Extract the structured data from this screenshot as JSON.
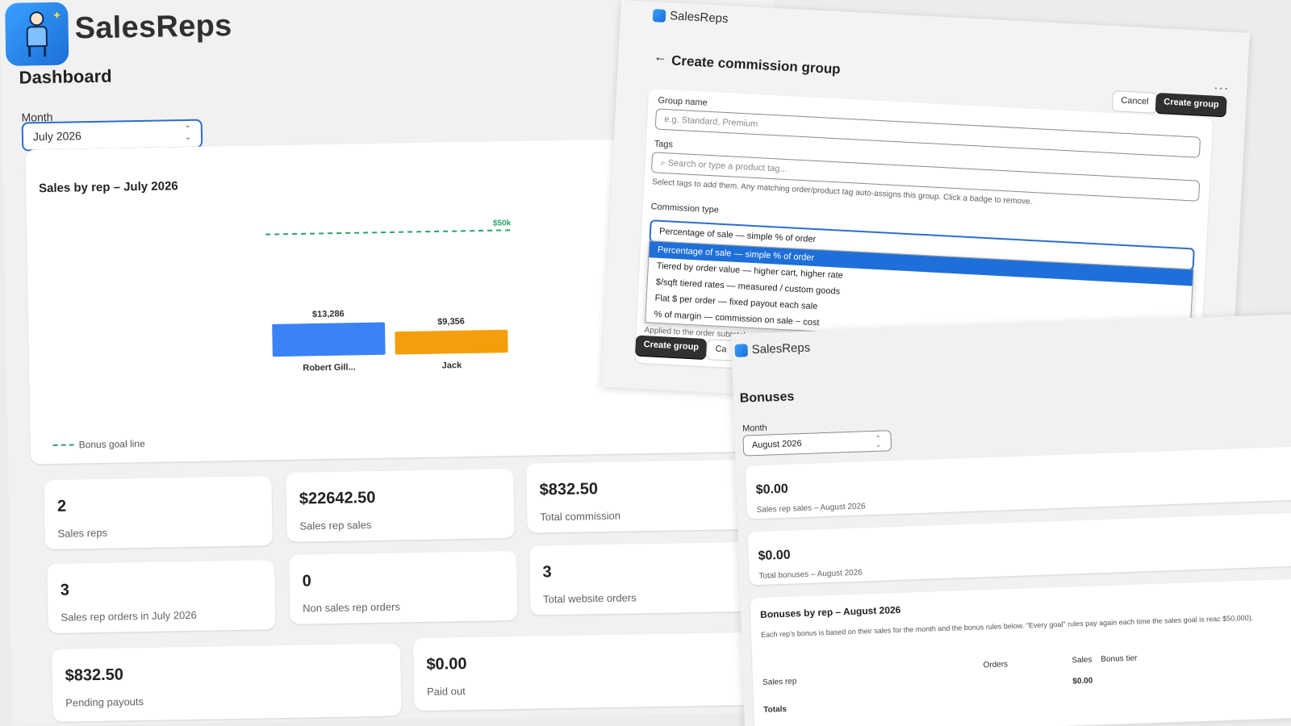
{
  "dashboard": {
    "brand": "SalesReps",
    "title": "Dashboard",
    "month_label": "Month",
    "month_value": "July 2026",
    "chart_card_title": "Sales by rep – July 2026",
    "legend_label": "Bonus goal line",
    "goal_label": "$50k",
    "stats": [
      {
        "value": "2",
        "label": "Sales reps"
      },
      {
        "value": "$22642.50",
        "label": "Sales rep sales"
      },
      {
        "value": "$832.50",
        "label": "Total commission"
      },
      {
        "value": "3",
        "label": "Sales rep orders in July 2026"
      },
      {
        "value": "0",
        "label": "Non sales rep orders"
      },
      {
        "value": "3",
        "label": "Total website orders"
      },
      {
        "value": "$832.50",
        "label": "Pending payouts"
      },
      {
        "value": "$0.00",
        "label": "Paid out"
      }
    ]
  },
  "chart_data": {
    "type": "bar",
    "title": "Sales by rep – July 2026",
    "categories": [
      "Robert Gill...",
      "Jack"
    ],
    "values": [
      13286,
      9356
    ],
    "value_labels": [
      "$13,286",
      "$9,356"
    ],
    "colors": [
      "#3b82f6",
      "#f59e0b"
    ],
    "goal_line": {
      "value": 50000,
      "label": "$50k",
      "color": "#27a36a"
    },
    "legend": [
      "Bonus goal line"
    ],
    "ylim": [
      0,
      60000
    ],
    "grid": false,
    "legend_position": "bottom-left"
  },
  "commission_group": {
    "brand": "SalesReps",
    "title": "Create commission group",
    "cancel_label": "Cancel",
    "create_label": "Create group",
    "group_name_label": "Group name",
    "group_name_placeholder": "e.g. Standard, Premium",
    "tags_label": "Tags",
    "tags_placeholder": "Search or type a product tag...",
    "tags_help": "Select tags to add them. Any matching order/product tag auto-assigns this group. Click a badge to remove.",
    "commission_type_label": "Commission type",
    "commission_type_value": "Percentage of sale — simple % of order",
    "options": [
      "Percentage of sale — simple % of order",
      "Tiered by order value — higher cart, higher rate",
      "$/sqft tiered rates — measured / custom goods",
      "Flat $ per order — fixed payout each sale",
      "% of margin — commission on sale − cost"
    ],
    "applied_note": "Applied to the order subtotal.",
    "bottom_create_label": "Create group",
    "bottom_cancel_label": "Ca"
  },
  "bonuses": {
    "brand": "SalesReps",
    "title": "Bonuses",
    "month_label": "Month",
    "month_value": "August 2026",
    "cards": [
      {
        "value": "$0.00",
        "label": "Sales rep sales – August 2026"
      },
      {
        "value": "$0.00",
        "label": "Total bonuses – August 2026"
      }
    ],
    "table_title": "Bonuses by rep – August 2026",
    "table_desc": "Each rep's bonus is based on their sales for the month and the bonus rules below. \"Every goal\" rules pay again each time the sales goal is reac $50,000).",
    "columns": [
      "Sales rep",
      "Orders",
      "Sales",
      "Bonus tier"
    ],
    "totals_label": "Totals",
    "totals_sales": "$0.00"
  }
}
